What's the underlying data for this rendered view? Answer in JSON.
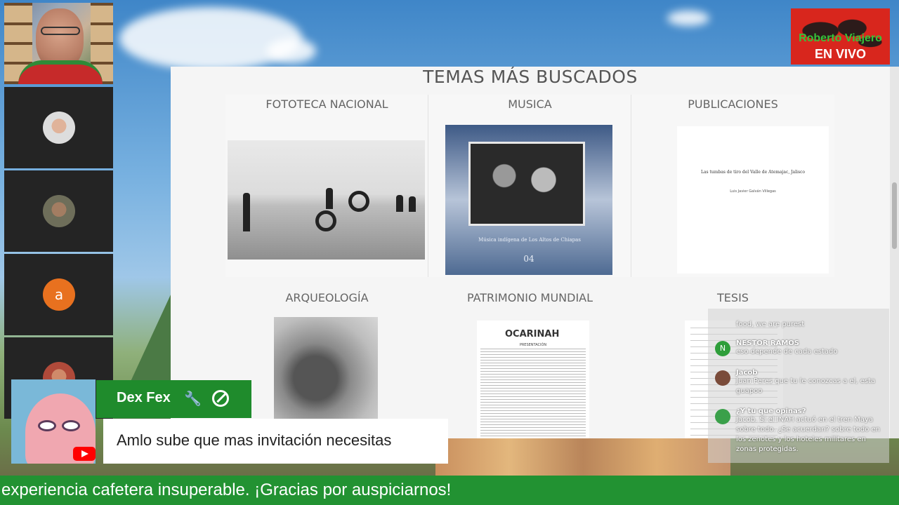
{
  "logo": {
    "name": "Roberto Viajero",
    "live": "EN VIVO"
  },
  "participants": [
    {
      "type": "video",
      "label": "host"
    },
    {
      "type": "avatar",
      "label": "participant-2"
    },
    {
      "type": "avatar",
      "label": "participant-3"
    },
    {
      "type": "letter",
      "letter": "a"
    },
    {
      "type": "avatar",
      "label": "participant-5"
    }
  ],
  "webpage": {
    "title": "TEMAS MÁS BUSCADOS",
    "cards": [
      "FOTOTECA NACIONAL",
      "MUSICA",
      "PUBLICACIONES",
      "ARQUEOLOGÍA",
      "PATRIMONIO MUNDIAL",
      "TESIS"
    ],
    "cd_cover": {
      "text": "Música indígena de Los Altos de Chiapas",
      "number": "04"
    },
    "publication": {
      "title": "Las tumbas de tiro del Valle de Atemajac, Jalisco",
      "author": "Luis Javier Galván Villegas"
    },
    "document": {
      "logo": "OCARINAH",
      "subtitle": "PRESENTACIÓN"
    }
  },
  "chat": [
    {
      "author": "",
      "text": "food, we are purest"
    },
    {
      "author": "NESTOR RAMOS",
      "text": "eso depende de cada estado",
      "initial": "N",
      "color": "#2e9e3a"
    },
    {
      "author": "Jacob",
      "text": "Juan Peres que tu le conozcas a el, esta guapoo",
      "color": "#7a4b3a"
    },
    {
      "author": "¿Y tu que opinas?",
      "text": "Jacob. Si el INAH actuó en el tren Maya sobre todo. ¿Se acuerdan? sobre todo en los zenotes y los hoteles militares en zonas protegidas.",
      "color": "#3aa04a"
    }
  ],
  "highlight": {
    "name": "Dex Fex",
    "message": "Amlo sube que mas invitación necesitas"
  },
  "ticker": "experiencia cafetera insuperable. ¡Gracias por auspiciarnos!",
  "colors": {
    "accent_green": "#229232",
    "logo_red": "#d8261d",
    "youtube_red": "#ff0000"
  }
}
